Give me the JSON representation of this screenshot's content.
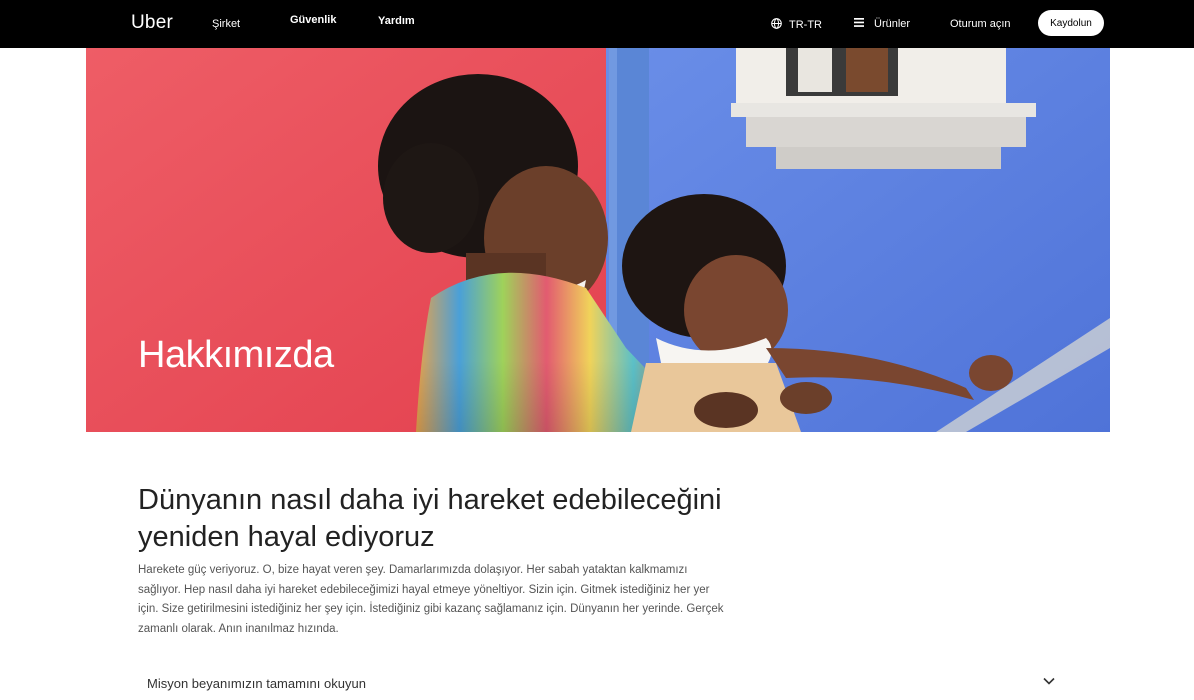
{
  "nav": {
    "logo": "Uber",
    "links": {
      "company": "Şirket",
      "safety": "Güvenlik",
      "help": "Yardım"
    },
    "language": "TR-TR",
    "products": "Ürünler",
    "login": "Oturum açın",
    "signup": "Kaydolun",
    "icons": [
      "globe-icon",
      "menu-icon"
    ]
  },
  "hero": {
    "title": "Hakkımızda",
    "colors": {
      "left_wall": "#e8505b",
      "right_wall": "#5b7fe0"
    }
  },
  "main": {
    "headline": "Dünyanın nasıl daha iyi hareket edebileceğini yeniden hayal ediyoruz",
    "body": "Harekete güç veriyoruz. O, bize hayat veren şey. Damarlarımızda dolaşıyor. Her sabah yataktan kalkmamızı sağlıyor. Hep nasıl daha iyi hareket edebileceğimizi hayal etmeye yöneltiyor. Sizin için. Gitmek istediğiniz her yer için. Size getirilmesini istediğiniz her şey için. İstediğiniz gibi kazanç sağlamanız için. Dünyanın her yerinde. Gerçek zamanlı olarak. Anın inanılmaz hızında.",
    "accordion_label": "Misyon beyanımızın tamamını okuyun"
  }
}
